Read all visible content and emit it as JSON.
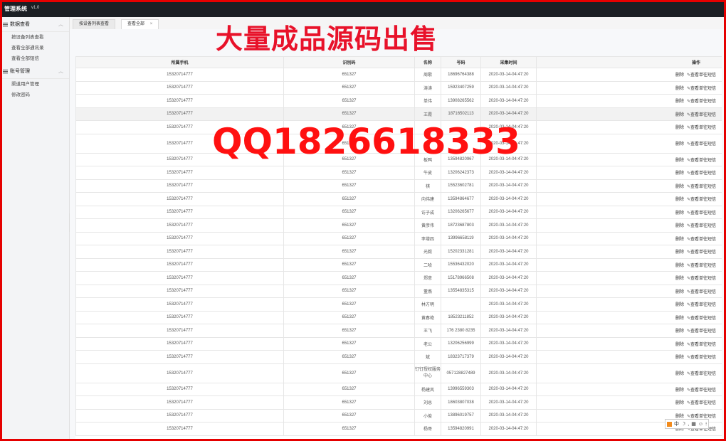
{
  "app": {
    "title": "管理系统",
    "version": "v1.0"
  },
  "sidebar": {
    "groups": [
      {
        "label": "数据查看",
        "items": [
          "按设备列表查看",
          "查看全部通讯录",
          "查看全部短信"
        ]
      },
      {
        "label": "账号管理",
        "items": [
          "渠道用户管理",
          "修改密码"
        ]
      }
    ]
  },
  "tabs": [
    {
      "label": "按设备列表查看"
    },
    {
      "label": "查看全部",
      "close": "×"
    }
  ],
  "overlay": {
    "banner": "大量成品源码出售",
    "qq": "QQ1826618333"
  },
  "table": {
    "headers": [
      "所属手机",
      "识别码",
      "名称",
      "号码",
      "采集时间",
      "操作"
    ],
    "op_delete": "删除",
    "op_view": "查看单往短信",
    "rows": [
      [
        "15320714777",
        "651327",
        "周歌",
        "18696764388",
        "2020-03-14-04:47:20"
      ],
      [
        "15320714777",
        "651327",
        "涛涛",
        "15923407259",
        "2020-03-14-04:47:20"
      ],
      [
        "15320714777",
        "651327",
        "单伟",
        "13908265562",
        "2020-03-14-04:47:20"
      ],
      [
        "15320714777",
        "651327",
        "王霞",
        "18716502113",
        "2020-03-14-04:47:20"
      ],
      [
        "15320714777",
        "651327",
        "",
        "",
        "2020-03-14-04:47:20"
      ],
      [
        "15320714777",
        "651327",
        "",
        "",
        "2020-03-14-04:47:20"
      ],
      [
        "15320714777",
        "651327",
        "板鸭",
        "13594820967",
        "2020-03-14-04:47:20"
      ],
      [
        "15320714777",
        "651327",
        "牛皮",
        "13206242373",
        "2020-03-14-04:47:20"
      ],
      [
        "15320714777",
        "651327",
        "棋",
        "15523602781",
        "2020-03-14-04:47:20"
      ],
      [
        "15320714777",
        "651327",
        "向伟建",
        "13594864677",
        "2020-03-14-04:47:20"
      ],
      [
        "15320714777",
        "651327",
        "访子成",
        "13206265677",
        "2020-03-14-04:47:20"
      ],
      [
        "15320714777",
        "651327",
        "黄彦伟",
        "18723687803",
        "2020-03-14-04:47:20"
      ],
      [
        "15320714777",
        "651327",
        "李增四",
        "13996658119",
        "2020-03-14-04:47:20"
      ],
      [
        "15320714777",
        "651327",
        "光毅",
        "15202331281",
        "2020-03-14-04:47:20"
      ],
      [
        "15320714777",
        "651327",
        "二哈",
        "15536432020",
        "2020-03-14-04:47:20"
      ],
      [
        "15320714777",
        "651327",
        "郑意",
        "15178966508",
        "2020-03-14-04:47:20"
      ],
      [
        "15320714777",
        "651327",
        "董燕",
        "13554835315",
        "2020-03-14-04:47:20"
      ],
      [
        "15320714777",
        "651327",
        "林方明",
        "",
        "2020-03-14-04:47:20"
      ],
      [
        "15320714777",
        "651327",
        "黄春艳",
        "18523211852",
        "2020-03-14-04:47:20"
      ],
      [
        "15320714777",
        "651327",
        "王飞",
        "176 2380 8235",
        "2020-03-14-04:47:20"
      ],
      [
        "15320714777",
        "651327",
        "老公",
        "13206256999",
        "2020-03-14-04:47:20"
      ],
      [
        "15320714777",
        "651327",
        "斌",
        "18323717379",
        "2020-03-14-04:47:20"
      ],
      [
        "15320714777",
        "651327",
        "钉钉授权服务中心",
        "057128827489",
        "2020-03-14-04:47:20"
      ],
      [
        "15320714777",
        "651327",
        "杨建风",
        "13996559303",
        "2020-03-14-04:47:20"
      ],
      [
        "15320714777",
        "651327",
        "刘总",
        "18603807038",
        "2020-03-14-04:47:20"
      ],
      [
        "15320714777",
        "651327",
        "小俊",
        "13896019757",
        "2020-03-14-04:47:20"
      ],
      [
        "15320714777",
        "651327",
        "杨哥",
        "13594820991",
        "2020-03-14-04:47:20"
      ]
    ]
  },
  "tray": {
    "label": "中"
  }
}
